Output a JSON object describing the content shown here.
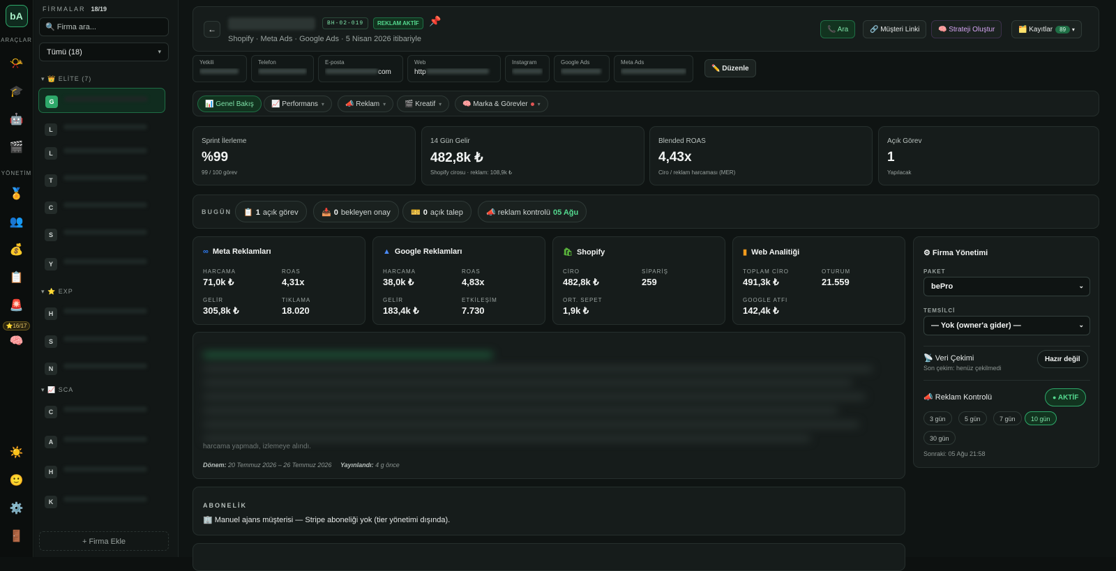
{
  "rail": {
    "logo": "bA",
    "tools_label": "ARAÇLAR",
    "management_label": "YÖNETİM",
    "badge": "⭐16/17"
  },
  "sidebar": {
    "title": "FİRMALAR",
    "count": "18/19",
    "search_placeholder": "🔍 Firma ara...",
    "filter": "Tümü (18)",
    "groups": [
      {
        "label": "▾ 👑 ELİTE (7)"
      },
      {
        "label": "▾ ⭐ EXP"
      },
      {
        "label": "▾ 📈 SCA"
      }
    ],
    "items": [
      {
        "letter": "G"
      },
      {
        "letter": "L"
      },
      {
        "letter": "L"
      },
      {
        "letter": "T"
      },
      {
        "letter": "C"
      },
      {
        "letter": "S"
      },
      {
        "letter": "Y"
      },
      {
        "letter": "H"
      },
      {
        "letter": "S"
      },
      {
        "letter": "N"
      },
      {
        "letter": "C"
      },
      {
        "letter": "A"
      },
      {
        "letter": "H"
      },
      {
        "letter": "K"
      }
    ],
    "add_label": "+ Firma Ekle"
  },
  "header": {
    "code": "BH-02-019",
    "status": "REKLAM AKTİF",
    "subtitle": "Shopify · Meta Ads · Google Ads · 5 Nisan 2026 itibariyle",
    "buttons": {
      "call": "📞 Ara",
      "link": "🔗 Müşteri Linki",
      "strategy": "🧠 Strateji Oluştur",
      "records": "🗂️ Kayıtlar",
      "records_count": "89"
    }
  },
  "info": {
    "yetkili_label": "Yetkili",
    "telefon_label": "Telefon",
    "eposta_label": "E-posta",
    "eposta_suffix": "com",
    "web_label": "Web",
    "web_prefix": "http",
    "instagram_label": "Instagram",
    "google_ads_label": "Google Ads",
    "meta_ads_label": "Meta Ads",
    "edit": "✏️ Düzenle"
  },
  "tabs": [
    {
      "label": "📊 Genel Bakış"
    },
    {
      "label": "📈 Performans"
    },
    {
      "label": "📣 Reklam"
    },
    {
      "label": "🎬 Kreatif"
    },
    {
      "label": "🧠 Marka & Görevler"
    }
  ],
  "kpis": [
    {
      "label": "Sprint İlerleme",
      "value": "%99",
      "sub": "99 / 100 görev"
    },
    {
      "label": "14 Gün Gelir",
      "value": "482,8k ₺",
      "sub": "Shopify cirosu · reklam: 108,9k ₺"
    },
    {
      "label": "Blended ROAS",
      "value": "4,43x",
      "sub": "Ciro / reklam harcaması (MER)"
    },
    {
      "label": "Açık Görev",
      "value": "1",
      "sub": "Yapılacak"
    }
  ],
  "today": {
    "label": "BUGÜN",
    "open_tasks": {
      "icon": "📋",
      "count": "1",
      "label": "açık görev"
    },
    "pending": {
      "icon": "📥",
      "count": "0",
      "label": "bekleyen onay"
    },
    "requests": {
      "icon": "🎫",
      "count": "0",
      "label": "açık talep"
    },
    "ad_check": {
      "label": "📣 reklam kontrolü",
      "date": "05 Ağu"
    }
  },
  "platforms": {
    "meta": {
      "title": "Meta Reklamları",
      "l1": "HARCAMA",
      "v1": "71,0k ₺",
      "l2": "ROAS",
      "v2": "4,31x",
      "l3": "GELİR",
      "v3": "305,8k ₺",
      "l4": "TIKLAMA",
      "v4": "18.020"
    },
    "google": {
      "title": "Google Reklamları",
      "l1": "HARCAMA",
      "v1": "38,0k ₺",
      "l2": "ROAS",
      "v2": "4,83x",
      "l3": "GELİR",
      "v3": "183,4k ₺",
      "l4": "ETKİLEŞİM",
      "v4": "7.730"
    },
    "shopify": {
      "title": "Shopify",
      "l1": "CİRO",
      "v1": "482,8k ₺",
      "l2": "SİPARİŞ",
      "v2": "259",
      "l3": "ORT. SEPET",
      "v3": "1,9k ₺"
    },
    "web": {
      "title": "Web Analitiği",
      "l1": "TOPLAM CİRO",
      "v1": "491,3k ₺",
      "l2": "OTURUM",
      "v2": "21.559",
      "l3": "GOOGLE ATFI",
      "v3": "142,4k ₺"
    }
  },
  "report": {
    "last_line": "harcama yapmadı, izlemeye alındı.",
    "period_label": "Dönem:",
    "period": "20 Temmuz 2026 – 26 Temmuz 2026",
    "published_label": "Yayınlandı:",
    "published": "4 g önce"
  },
  "subscription": {
    "label": "ABONELİK",
    "text": "🏢 Manuel ajans müşterisi — Stripe aboneliği yok (tier yönetimi dışında)."
  },
  "management": {
    "title": "⚙ Firma Yönetimi",
    "package_label": "PAKET",
    "package": "bePro",
    "rep_label": "TEMSİLCİ",
    "rep": "— Yok (owner'a gider) —",
    "data_pull": "📡 Veri Çekimi",
    "data_pull_sub": "Son çekim: henüz çekilmedi",
    "data_pull_btn": "Hazır değil",
    "ad_check": "📣 Reklam Kontrolü",
    "ad_check_btn": "AKTİF",
    "intervals": [
      "3 gün",
      "5 gün",
      "7 gün",
      "10 gün",
      "30 gün"
    ],
    "next": "Sonraki: 05 Ağu 21:58"
  },
  "colors": {
    "accent": "#2ea86a",
    "accent_text": "#54d98f",
    "bg": "#0f1413",
    "card": "#161c1b"
  }
}
